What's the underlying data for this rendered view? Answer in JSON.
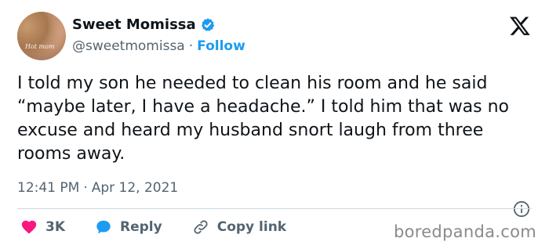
{
  "author": {
    "display_name": "Sweet Momissa",
    "handle": "@sweetmomissa",
    "separator": "·",
    "follow_label": "Follow",
    "avatar_overlay_text": "Hot mom"
  },
  "tweet": {
    "text": "I told my son he needed to clean his room and he said “maybe later, I have a headache.” I told him that was no excuse and heard my husband snort laugh from three rooms away.",
    "time": "12:41 PM",
    "meta_separator": "·",
    "date": "Apr 12, 2021"
  },
  "actions": {
    "like_count": "3K",
    "reply_label": "Reply",
    "copy_link_label": "Copy link"
  },
  "watermark": "boredpanda.com",
  "colors": {
    "accent_blue": "#1d9bf0",
    "like_red": "#f91880",
    "muted_gray": "#536471"
  }
}
